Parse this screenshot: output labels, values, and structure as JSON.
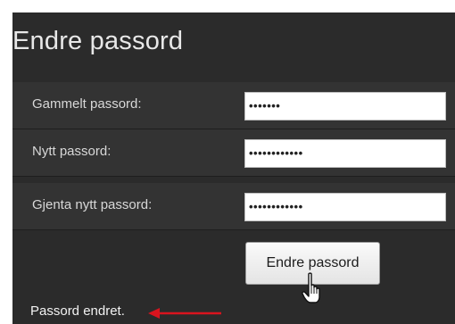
{
  "form": {
    "title": "Endre passord",
    "fields": [
      {
        "label": "Gammelt passord:",
        "value": "•••••••"
      },
      {
        "label": "Nytt passord:",
        "value": "••••••••••••"
      },
      {
        "label": "Gjenta nytt passord:",
        "value": "••••••••••••"
      }
    ],
    "submit_label": "Endre passord",
    "status": "Passord endret."
  },
  "icons": {
    "cursor": "hand-pointer-icon",
    "arrow": "arrow-left-icon"
  },
  "colors": {
    "panel": "#2b2b2b",
    "row": "#333333",
    "arrow": "#d9141e"
  }
}
